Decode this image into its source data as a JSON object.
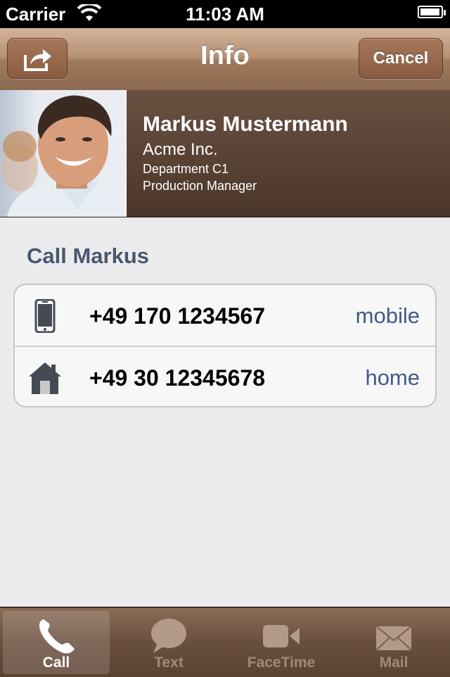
{
  "status_bar": {
    "carrier": "Carrier",
    "time": "11:03 AM"
  },
  "navbar": {
    "title": "Info",
    "cancel_label": "Cancel",
    "share_icon": "share-icon"
  },
  "contact": {
    "name": "Markus Mustermann",
    "company": "Acme Inc.",
    "department": "Department C1",
    "role": "Production Manager"
  },
  "call_section": {
    "title": "Call Markus",
    "numbers": [
      {
        "number": "+49 170 1234567",
        "label": "mobile",
        "icon": "mobile-phone-icon"
      },
      {
        "number": "+49 30 12345678",
        "label": "home",
        "icon": "house-icon"
      }
    ]
  },
  "tabbar": {
    "tabs": [
      {
        "label": "Call",
        "icon": "phone-handset-icon",
        "active": true
      },
      {
        "label": "Text",
        "icon": "speech-bubble-icon",
        "active": false
      },
      {
        "label": "FaceTime",
        "icon": "video-camera-icon",
        "active": false
      },
      {
        "label": "Mail",
        "icon": "envelope-icon",
        "active": false
      }
    ]
  },
  "colors": {
    "nav_brown": "#a07a5d",
    "header_brown": "#4a3629",
    "link_blue": "#415a8a",
    "section_title": "#4a566f"
  }
}
